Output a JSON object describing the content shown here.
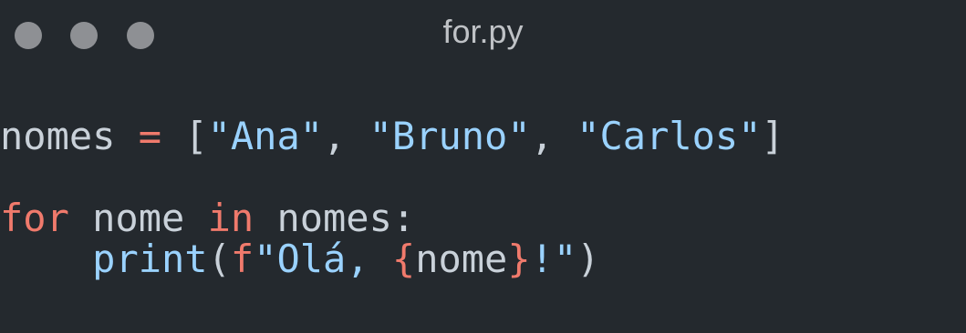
{
  "window": {
    "title": "for.py",
    "traffic_light_color": "#8e9094",
    "background": "#24292e"
  },
  "code": {
    "language": "python",
    "lines": [
      [
        {
          "text": "nomes",
          "kind": "plain"
        },
        {
          "text": " ",
          "kind": "plain"
        },
        {
          "text": "=",
          "kind": "op"
        },
        {
          "text": " [",
          "kind": "punc"
        },
        {
          "text": "\"Ana\"",
          "kind": "str"
        },
        {
          "text": ", ",
          "kind": "punc"
        },
        {
          "text": "\"Bruno\"",
          "kind": "str"
        },
        {
          "text": ", ",
          "kind": "punc"
        },
        {
          "text": "\"Carlos\"",
          "kind": "str"
        },
        {
          "text": "]",
          "kind": "punc"
        }
      ],
      [],
      [
        {
          "text": "for",
          "kind": "kw"
        },
        {
          "text": " nome ",
          "kind": "plain"
        },
        {
          "text": "in",
          "kind": "kw"
        },
        {
          "text": " nomes:",
          "kind": "plain"
        }
      ],
      [
        {
          "text": "    ",
          "kind": "plain"
        },
        {
          "text": "print",
          "kind": "fn"
        },
        {
          "text": "(",
          "kind": "punc"
        },
        {
          "text": "f",
          "kind": "kw"
        },
        {
          "text": "\"Olá, ",
          "kind": "str"
        },
        {
          "text": "{",
          "kind": "op"
        },
        {
          "text": "nome",
          "kind": "plain"
        },
        {
          "text": "}",
          "kind": "op"
        },
        {
          "text": "!\"",
          "kind": "str"
        },
        {
          "text": ")",
          "kind": "punc"
        }
      ]
    ]
  },
  "colors": {
    "keyword": "#f07a6c",
    "string": "#9ad2ff",
    "plain": "#c9d1d9",
    "title": "#bfc2c6"
  }
}
